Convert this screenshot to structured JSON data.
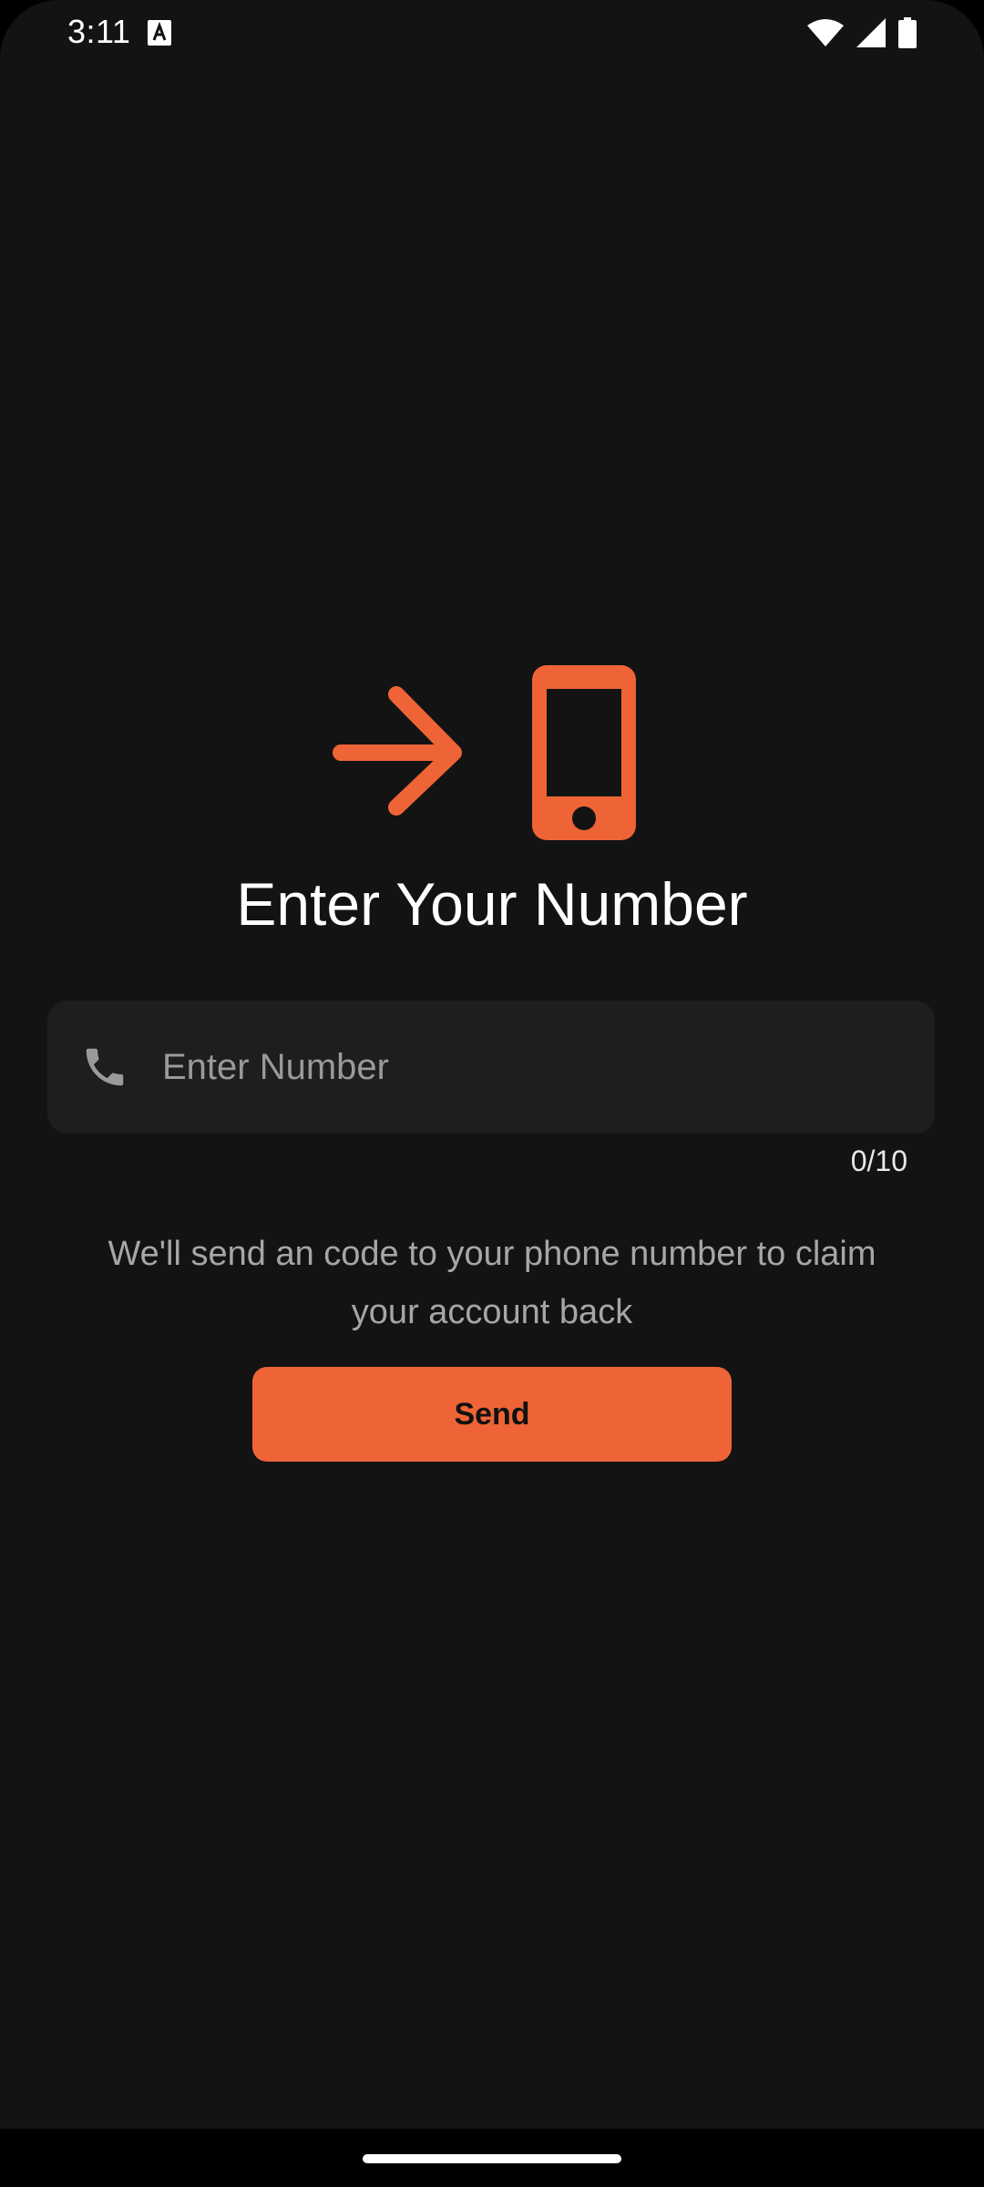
{
  "status_bar": {
    "time": "3:11",
    "notification_icon": "text-a-icon",
    "wifi_icon": "wifi-icon",
    "signal_icon": "cellular-signal-icon",
    "battery_icon": "battery-icon"
  },
  "hero": {
    "icon": "phone-with-arrow-icon",
    "title": "Enter Your Number"
  },
  "phone_input": {
    "icon": "phone-icon",
    "value": "",
    "placeholder": "Enter Number",
    "counter": "0/10"
  },
  "info": {
    "text": "We'll send an code to your phone number to claim your account back"
  },
  "send_button": {
    "label": "Send"
  },
  "colors": {
    "background": "#131313",
    "accent": "#ee6436",
    "input_background": "#1e1e1e",
    "muted_text": "#a6a6a6"
  }
}
